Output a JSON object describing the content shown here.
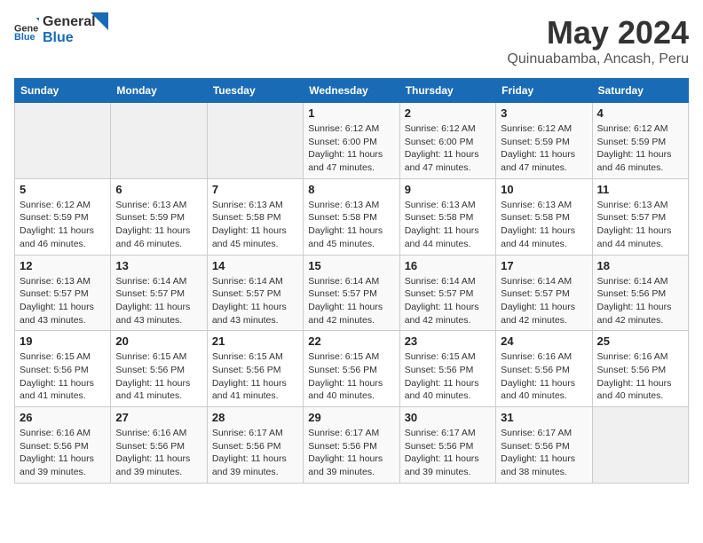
{
  "header": {
    "logo_general": "General",
    "logo_blue": "Blue",
    "title": "May 2024",
    "subtitle": "Quinuabamba, Ancash, Peru"
  },
  "days_of_week": [
    "Sunday",
    "Monday",
    "Tuesday",
    "Wednesday",
    "Thursday",
    "Friday",
    "Saturday"
  ],
  "weeks": [
    [
      {
        "day": "",
        "info": ""
      },
      {
        "day": "",
        "info": ""
      },
      {
        "day": "",
        "info": ""
      },
      {
        "day": "1",
        "info": "Sunrise: 6:12 AM\nSunset: 6:00 PM\nDaylight: 11 hours and 47 minutes."
      },
      {
        "day": "2",
        "info": "Sunrise: 6:12 AM\nSunset: 6:00 PM\nDaylight: 11 hours and 47 minutes."
      },
      {
        "day": "3",
        "info": "Sunrise: 6:12 AM\nSunset: 5:59 PM\nDaylight: 11 hours and 47 minutes."
      },
      {
        "day": "4",
        "info": "Sunrise: 6:12 AM\nSunset: 5:59 PM\nDaylight: 11 hours and 46 minutes."
      }
    ],
    [
      {
        "day": "5",
        "info": "Sunrise: 6:12 AM\nSunset: 5:59 PM\nDaylight: 11 hours and 46 minutes."
      },
      {
        "day": "6",
        "info": "Sunrise: 6:13 AM\nSunset: 5:59 PM\nDaylight: 11 hours and 46 minutes."
      },
      {
        "day": "7",
        "info": "Sunrise: 6:13 AM\nSunset: 5:58 PM\nDaylight: 11 hours and 45 minutes."
      },
      {
        "day": "8",
        "info": "Sunrise: 6:13 AM\nSunset: 5:58 PM\nDaylight: 11 hours and 45 minutes."
      },
      {
        "day": "9",
        "info": "Sunrise: 6:13 AM\nSunset: 5:58 PM\nDaylight: 11 hours and 44 minutes."
      },
      {
        "day": "10",
        "info": "Sunrise: 6:13 AM\nSunset: 5:58 PM\nDaylight: 11 hours and 44 minutes."
      },
      {
        "day": "11",
        "info": "Sunrise: 6:13 AM\nSunset: 5:57 PM\nDaylight: 11 hours and 44 minutes."
      }
    ],
    [
      {
        "day": "12",
        "info": "Sunrise: 6:13 AM\nSunset: 5:57 PM\nDaylight: 11 hours and 43 minutes."
      },
      {
        "day": "13",
        "info": "Sunrise: 6:14 AM\nSunset: 5:57 PM\nDaylight: 11 hours and 43 minutes."
      },
      {
        "day": "14",
        "info": "Sunrise: 6:14 AM\nSunset: 5:57 PM\nDaylight: 11 hours and 43 minutes."
      },
      {
        "day": "15",
        "info": "Sunrise: 6:14 AM\nSunset: 5:57 PM\nDaylight: 11 hours and 42 minutes."
      },
      {
        "day": "16",
        "info": "Sunrise: 6:14 AM\nSunset: 5:57 PM\nDaylight: 11 hours and 42 minutes."
      },
      {
        "day": "17",
        "info": "Sunrise: 6:14 AM\nSunset: 5:57 PM\nDaylight: 11 hours and 42 minutes."
      },
      {
        "day": "18",
        "info": "Sunrise: 6:14 AM\nSunset: 5:56 PM\nDaylight: 11 hours and 42 minutes."
      }
    ],
    [
      {
        "day": "19",
        "info": "Sunrise: 6:15 AM\nSunset: 5:56 PM\nDaylight: 11 hours and 41 minutes."
      },
      {
        "day": "20",
        "info": "Sunrise: 6:15 AM\nSunset: 5:56 PM\nDaylight: 11 hours and 41 minutes."
      },
      {
        "day": "21",
        "info": "Sunrise: 6:15 AM\nSunset: 5:56 PM\nDaylight: 11 hours and 41 minutes."
      },
      {
        "day": "22",
        "info": "Sunrise: 6:15 AM\nSunset: 5:56 PM\nDaylight: 11 hours and 40 minutes."
      },
      {
        "day": "23",
        "info": "Sunrise: 6:15 AM\nSunset: 5:56 PM\nDaylight: 11 hours and 40 minutes."
      },
      {
        "day": "24",
        "info": "Sunrise: 6:16 AM\nSunset: 5:56 PM\nDaylight: 11 hours and 40 minutes."
      },
      {
        "day": "25",
        "info": "Sunrise: 6:16 AM\nSunset: 5:56 PM\nDaylight: 11 hours and 40 minutes."
      }
    ],
    [
      {
        "day": "26",
        "info": "Sunrise: 6:16 AM\nSunset: 5:56 PM\nDaylight: 11 hours and 39 minutes."
      },
      {
        "day": "27",
        "info": "Sunrise: 6:16 AM\nSunset: 5:56 PM\nDaylight: 11 hours and 39 minutes."
      },
      {
        "day": "28",
        "info": "Sunrise: 6:17 AM\nSunset: 5:56 PM\nDaylight: 11 hours and 39 minutes."
      },
      {
        "day": "29",
        "info": "Sunrise: 6:17 AM\nSunset: 5:56 PM\nDaylight: 11 hours and 39 minutes."
      },
      {
        "day": "30",
        "info": "Sunrise: 6:17 AM\nSunset: 5:56 PM\nDaylight: 11 hours and 39 minutes."
      },
      {
        "day": "31",
        "info": "Sunrise: 6:17 AM\nSunset: 5:56 PM\nDaylight: 11 hours and 38 minutes."
      },
      {
        "day": "",
        "info": ""
      }
    ]
  ]
}
